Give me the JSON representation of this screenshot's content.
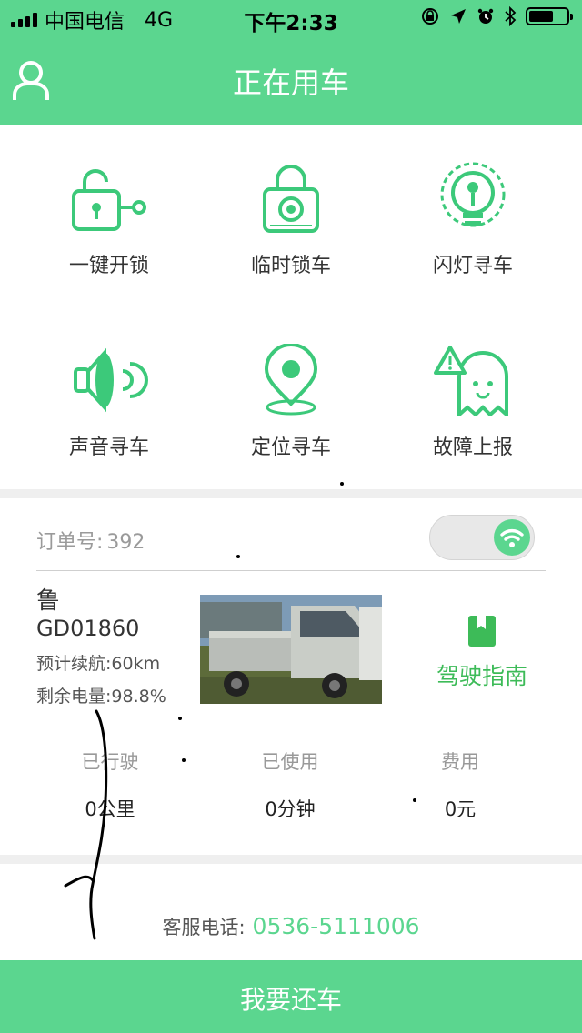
{
  "statusbar": {
    "carrier": "中国电信",
    "network": "4G",
    "time": "下午2:33"
  },
  "navbar": {
    "title": "正在用车"
  },
  "actions": [
    {
      "label": "一键开锁",
      "icon": "unlock-icon"
    },
    {
      "label": "临时锁车",
      "icon": "lock-icon"
    },
    {
      "label": "闪灯寻车",
      "icon": "lightbulb-icon"
    },
    {
      "label": "声音寻车",
      "icon": "horn-icon"
    },
    {
      "label": "定位寻车",
      "icon": "location-pin-icon"
    },
    {
      "label": "故障上报",
      "icon": "fault-report-icon"
    }
  ],
  "order": {
    "label": "订单号:",
    "number": "392"
  },
  "vehicle": {
    "plate_line1": "鲁",
    "plate_line2": "GD01860",
    "range": "预计续航:60km",
    "battery": "剩余电量:98.8%"
  },
  "guide": {
    "label": "驾驶指南"
  },
  "stats": [
    {
      "label": "已行驶",
      "value": "0公里"
    },
    {
      "label": "已使用",
      "value": "0分钟"
    },
    {
      "label": "费用",
      "value": "0元"
    }
  ],
  "service": {
    "label": "客服电话:",
    "phone": "0536-5111006"
  },
  "return_button": {
    "label": "我要还车"
  },
  "colors": {
    "brand_green": "#5bd68f",
    "guide_green": "#3dbb58"
  }
}
